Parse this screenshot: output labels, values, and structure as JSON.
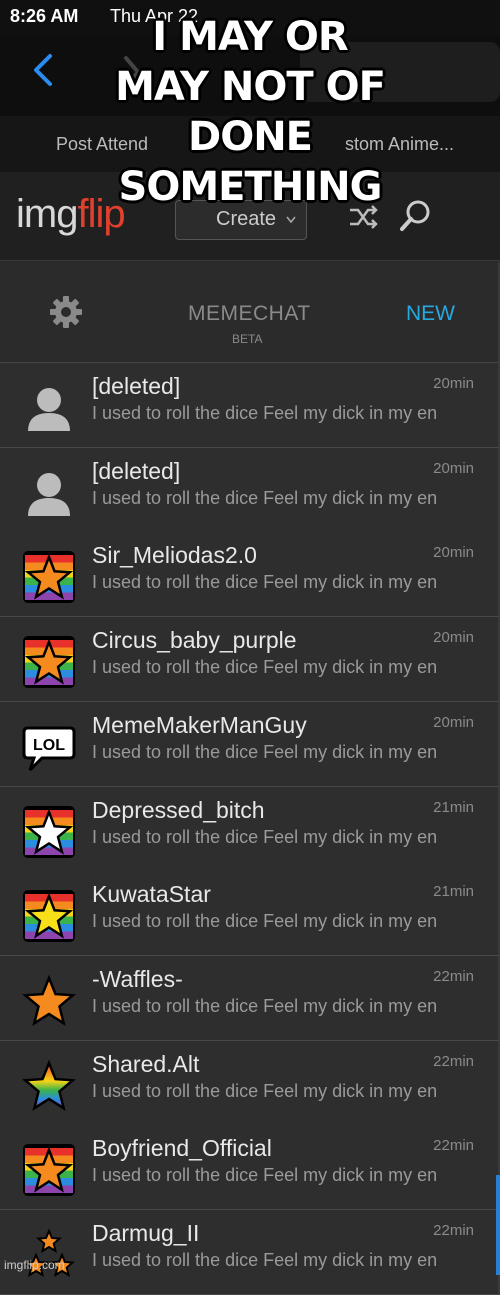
{
  "status_bar": {
    "time": "8:26 AM",
    "date": "Thu Apr 22"
  },
  "tabs": {
    "left": "Post Attend",
    "right": "stom Anime..."
  },
  "site": {
    "logo_main": "img",
    "logo_accent": "flip",
    "create_label": "Create",
    "brand_color": "#e0402c"
  },
  "memechat": {
    "title": "MEMECHAT",
    "beta": "BETA",
    "new_label": "NEW",
    "accent": "#25a9e0"
  },
  "chats": [
    {
      "name": "[deleted]",
      "message": "I used to roll the dice Feel my dick in my en",
      "time": "20min",
      "avatar": "person-icon"
    },
    {
      "name": "[deleted]",
      "message": "I used to roll the dice Feel my dick in my en",
      "time": "20min",
      "avatar": "person-icon"
    },
    {
      "name": "Sir_Meliodas2.0",
      "message": "I used to roll the dice Feel my dick in my en",
      "time": "20min",
      "avatar": "rainbow-orange-star-icon"
    },
    {
      "name": "Circus_baby_purple",
      "message": "I used to roll the dice Feel my dick in my en",
      "time": "20min",
      "avatar": "rainbow-orange-star-icon"
    },
    {
      "name": "MemeMakerManGuy",
      "message": "I used to roll the dice Feel my dick in my en",
      "time": "20min",
      "avatar": "lol-bubble-icon"
    },
    {
      "name": "Depressed_bitch",
      "message": "I used to roll the dice Feel my dick in my en",
      "time": "21min",
      "avatar": "rainbow-white-star-icon"
    },
    {
      "name": "KuwataStar",
      "message": "I used to roll the dice Feel my dick in my en",
      "time": "21min",
      "avatar": "rainbow-yellow-star-icon"
    },
    {
      "name": "-Waffles-",
      "message": "I used to roll the dice Feel my dick in my en",
      "time": "22min",
      "avatar": "orange-star-icon"
    },
    {
      "name": "Shared.Alt",
      "message": "I used to roll the dice Feel my dick in my en",
      "time": "22min",
      "avatar": "rainbow-star-icon"
    },
    {
      "name": "Boyfriend_Official",
      "message": "I used to roll the dice Feel my dick in my en",
      "time": "22min",
      "avatar": "rainbow-orange-star-icon"
    },
    {
      "name": "Darmug_II",
      "message": "I used to roll the dice Feel my dick in my en",
      "time": "22min",
      "avatar": "triple-star-icon"
    }
  ],
  "caption": "I MAY OR MAY NOT OF DONE SOMETHING",
  "watermark": "imgflip.com"
}
